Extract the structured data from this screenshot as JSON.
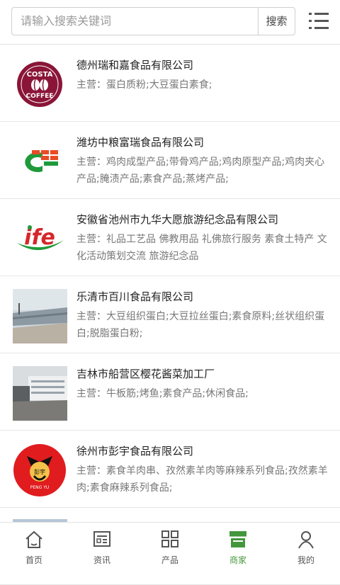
{
  "search": {
    "placeholder": "请输入搜索关键词",
    "button_label": "搜索"
  },
  "menu_icon": "list-menu-icon",
  "companies": [
    {
      "name": "德州瑞和嘉食品有限公司",
      "business": "主营：蛋白质粉;大豆蛋白素食;",
      "logo": "costa-coffee-logo"
    },
    {
      "name": "潍坊中粮富瑞食品有限公司",
      "business": "主营：鸡肉成型产品;带骨鸡产品;鸡肉原型产品;鸡肉夹心产品;腌渍产品;素食产品;蒸烤产品;",
      "logo": "cofco-logo"
    },
    {
      "name": "安徽省池州市九华大愿旅游纪念品有限公司",
      "business": "主营：礼品工艺品 佛教用品 礼佛旅行服务 素食土特产 文化活动策划交流 旅游纪念品",
      "logo": "ife-logo"
    },
    {
      "name": "乐清市百川食品有限公司",
      "business": "主营：大豆组织蛋白;大豆拉丝蛋白;素食原料;丝状组织蛋白;脱脂蛋白粉;",
      "logo": "factory-photo"
    },
    {
      "name": "吉林市船营区樱花酱菜加工厂",
      "business": "主营：牛板筋;烤鱼;素食产品;休闲食品;",
      "logo": "factory-photo"
    },
    {
      "name": "徐州市彭宇食品有限公司",
      "business": "主营：素食羊肉串、孜然素羊肉等麻辣系列食品;孜然素羊肉;素食麻辣系列食品;",
      "logo": "pengyu-logo",
      "logo_text": "彭宇",
      "logo_sub": "PENG YU"
    }
  ],
  "bottom_nav": [
    {
      "label": "首页",
      "icon": "home-icon",
      "active": false
    },
    {
      "label": "资讯",
      "icon": "news-icon",
      "active": false
    },
    {
      "label": "产品",
      "icon": "grid-icon",
      "active": false
    },
    {
      "label": "商家",
      "icon": "store-icon",
      "active": true
    },
    {
      "label": "我的",
      "icon": "user-icon",
      "active": false
    }
  ],
  "colors": {
    "accent": "#44963c",
    "text": "#222222",
    "muted": "#777777"
  }
}
